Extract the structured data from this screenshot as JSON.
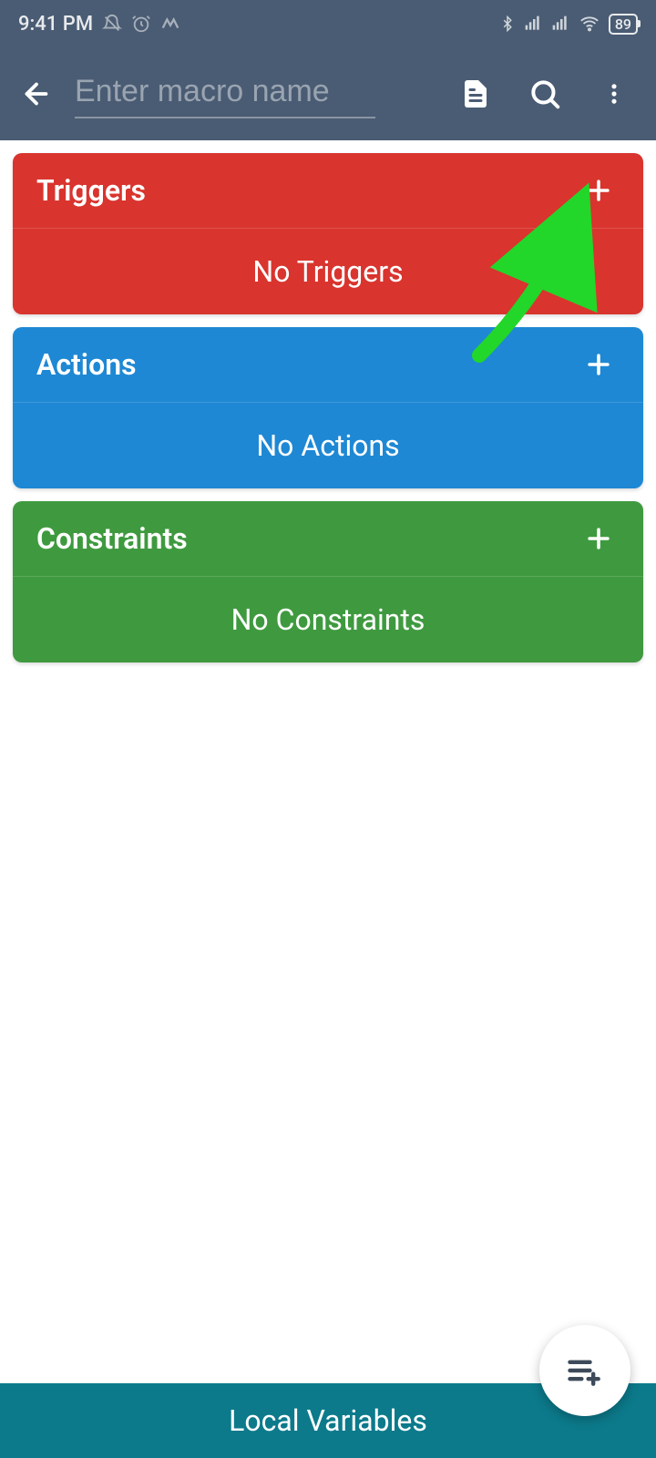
{
  "status": {
    "time": "9:41 PM",
    "battery": "89"
  },
  "appbar": {
    "placeholder": "Enter macro name",
    "value": ""
  },
  "cards": {
    "triggers": {
      "title": "Triggers",
      "empty": "No Triggers"
    },
    "actions": {
      "title": "Actions",
      "empty": "No Actions"
    },
    "constraints": {
      "title": "Constraints",
      "empty": "No Constraints"
    }
  },
  "footer": {
    "label": "Local Variables"
  }
}
